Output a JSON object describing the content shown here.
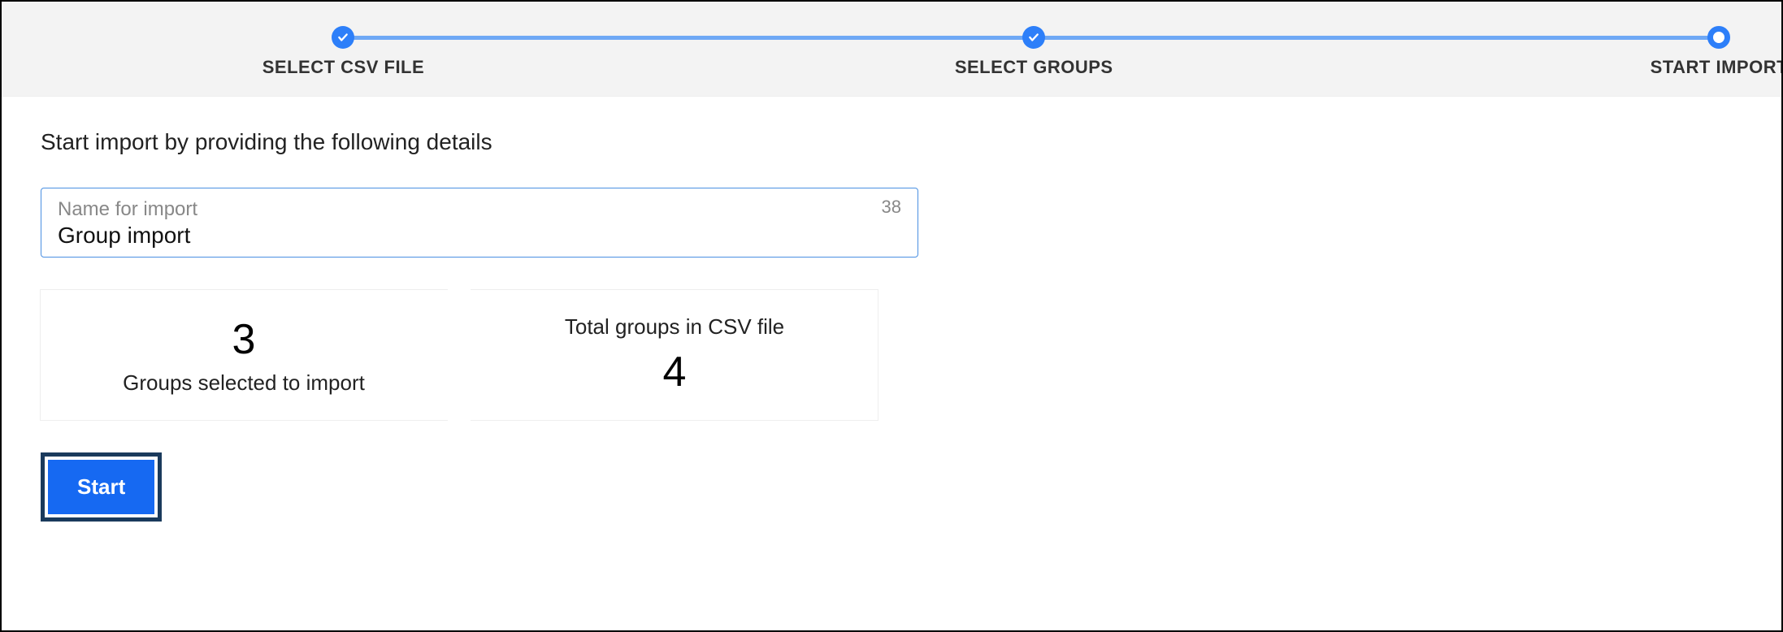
{
  "stepper": {
    "steps": [
      {
        "label": "SELECT CSV FILE",
        "state": "done"
      },
      {
        "label": "SELECT GROUPS",
        "state": "done"
      },
      {
        "label": "START IMPORT",
        "state": "current"
      }
    ]
  },
  "intro": "Start import by providing the following details",
  "input": {
    "label": "Name for import",
    "value": "Group import",
    "remaining": "38"
  },
  "cards": {
    "selected": {
      "value": "3",
      "label": "Groups selected to import"
    },
    "total": {
      "value": "4",
      "label": "Total groups in CSV file"
    }
  },
  "startButton": "Start",
  "colors": {
    "accent": "#2d7ff9",
    "stepperBg": "#f3f3f3",
    "inputBorder": "#4a90e2",
    "buttonOutline": "#1a3a5c"
  }
}
